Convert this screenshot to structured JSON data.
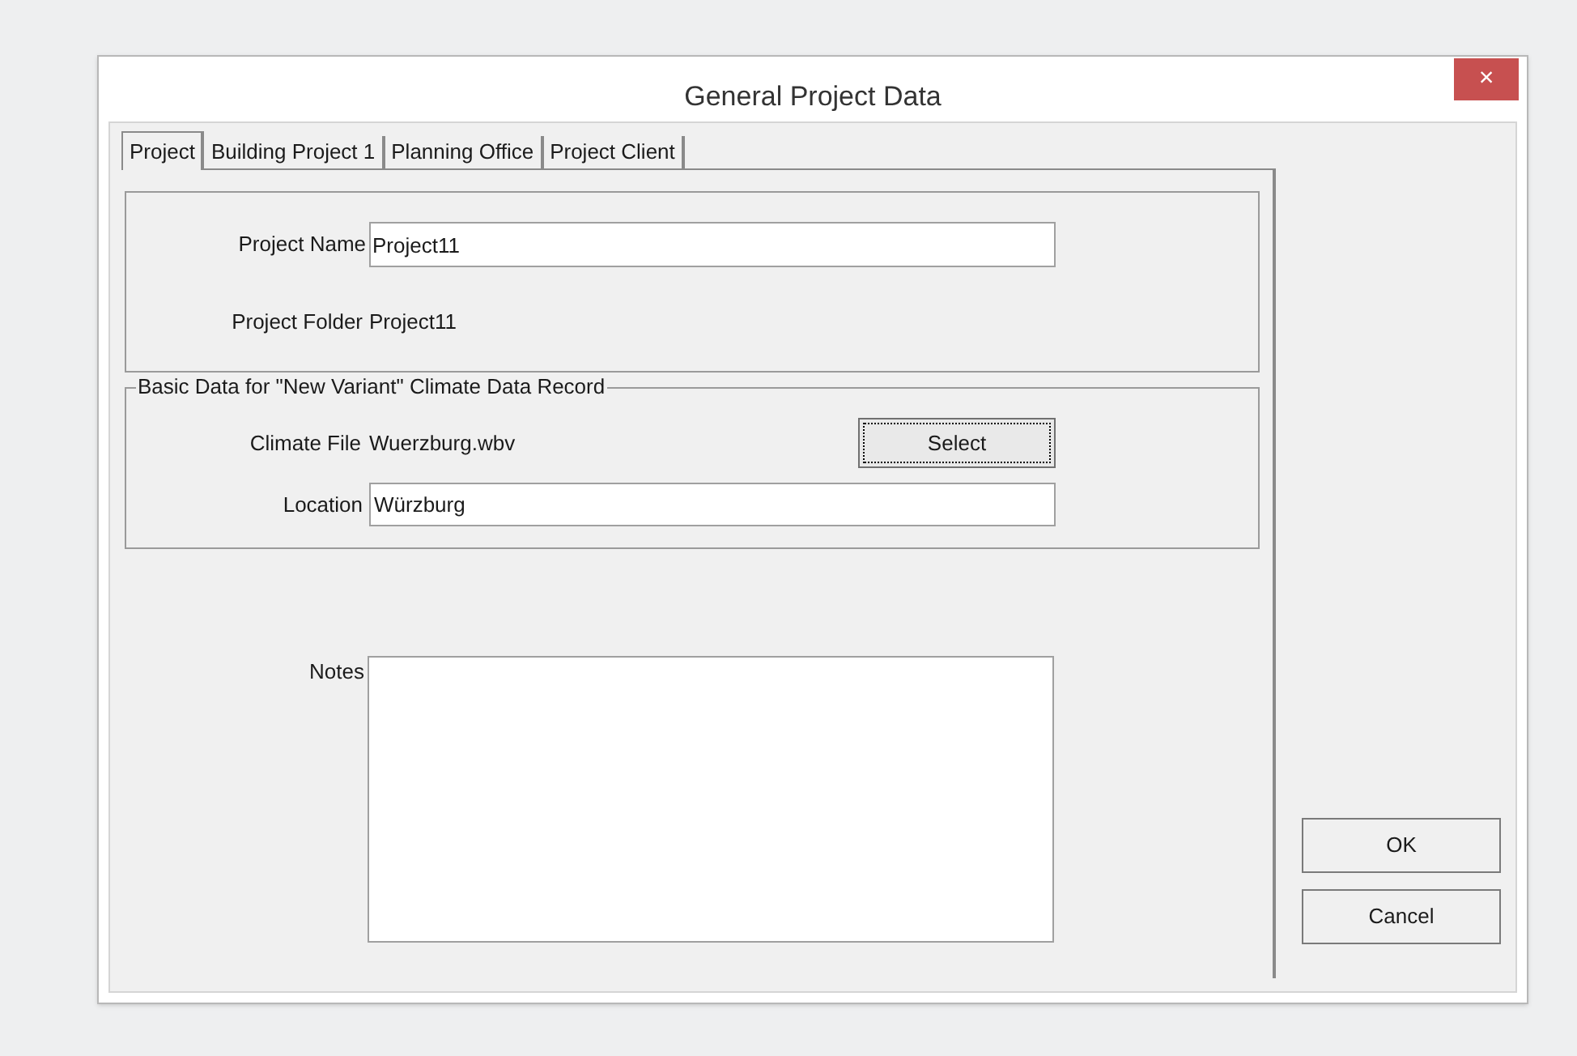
{
  "window": {
    "title": "General Project Data",
    "close": "×"
  },
  "tabs": [
    {
      "label": "Project",
      "selected": true
    },
    {
      "label": "Building Project 1",
      "selected": false
    },
    {
      "label": "Planning Office",
      "selected": false
    },
    {
      "label": "Project Client",
      "selected": false
    }
  ],
  "project": {
    "name_label": "Project Name",
    "name_value": "Project11",
    "folder_label": "Project Folder",
    "folder_value": "Project11"
  },
  "climate_group": {
    "legend": "Basic Data for \"New Variant\" Climate Data Record",
    "file_label": "Climate File",
    "file_value": "Wuerzburg.wbv",
    "select_button": "Select",
    "location_label": "Location",
    "location_value": "Würzburg"
  },
  "notes": {
    "label": "Notes"
  },
  "buttons": [
    "OK",
    "Cancel"
  ]
}
